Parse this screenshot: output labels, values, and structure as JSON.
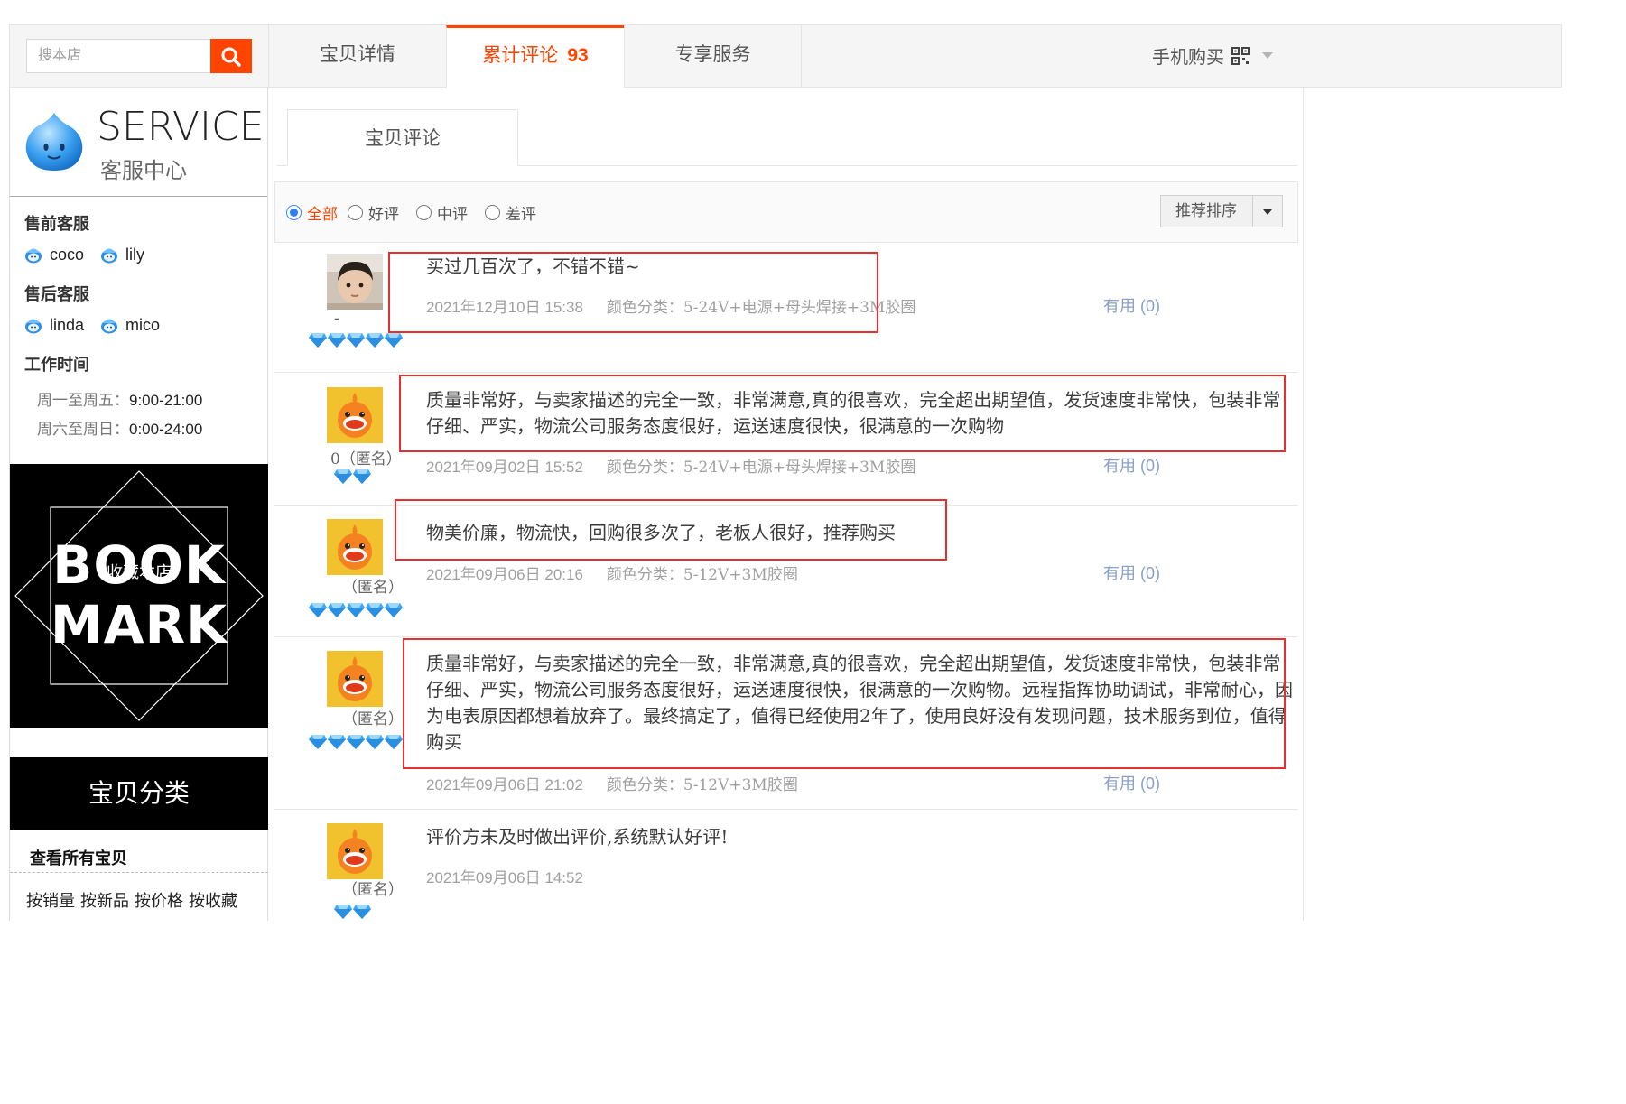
{
  "search": {
    "placeholder": "搜本店"
  },
  "tabs": [
    {
      "label": "宝贝详情"
    },
    {
      "label": "累计评论",
      "count": "93"
    },
    {
      "label": "专享服务"
    }
  ],
  "mobile_buy": "手机购买",
  "service": {
    "brand": "SERVICE",
    "subtitle": "客服中心",
    "presale_title": "售前客服",
    "presale": [
      "coco",
      "lily"
    ],
    "aftersale_title": "售后客服",
    "aftersale": [
      "linda",
      "mico"
    ],
    "hours_title": "工作时间",
    "hours": [
      {
        "days": "周一至周五：",
        "time": "9:00-21:00"
      },
      {
        "days": "周六至周日：",
        "time": "0:00-24:00"
      }
    ]
  },
  "bookmark": {
    "line1": "BOOK",
    "line2": "MARK",
    "overlay": "收藏本店"
  },
  "category": {
    "title": "宝贝分类",
    "all": "查看所有宝贝",
    "links": [
      "按销量",
      "按新品",
      "按价格",
      "按收藏"
    ]
  },
  "reviews_tab": "宝贝评论",
  "filters": [
    "全部",
    "好评",
    "中评",
    "差评"
  ],
  "sort_label": "推荐排序",
  "reviews": [
    {
      "user": "-",
      "anonymous": false,
      "gems": 5,
      "text": "买过几百次了，不错不错~",
      "date": "2021年12月10日 15:38",
      "sku": "颜色分类：5-24V+电源+母头焊接+3M胶圈",
      "useful": "有用 (0)",
      "avatar": "photo"
    },
    {
      "user": "0（匿名）",
      "anonymous": true,
      "gems": 2,
      "text": "质量非常好，与卖家描述的完全一致，非常满意,真的很喜欢，完全超出期望值，发货速度非常快，包装非常仔细、严实，物流公司服务态度很好，运送速度很快，很满意的一次购物",
      "date": "2021年09月02日 15:52",
      "sku": "颜色分类：5-24V+电源+母头焊接+3M胶圈",
      "useful": "有用 (0)",
      "avatar": "mascot"
    },
    {
      "user": "（匿名）",
      "anonymous": true,
      "gems": 5,
      "text": "物美价廉，物流快，回购很多次了，老板人很好，推荐购买",
      "date": "2021年09月06日 20:16",
      "sku": "颜色分类：5-12V+3M胶圈",
      "useful": "有用 (0)",
      "avatar": "mascot"
    },
    {
      "user": "（匿名）",
      "anonymous": true,
      "gems": 5,
      "text": "质量非常好，与卖家描述的完全一致，非常满意,真的很喜欢，完全超出期望值，发货速度非常快，包装非常仔细、严实，物流公司服务态度很好，运送速度很快，很满意的一次购物。远程指挥协助调试，非常耐心，因为电表原因都想着放弃了。最终搞定了，值得已经使用2年了，使用良好没有发现问题，技术服务到位，值得购买",
      "date": "2021年09月06日 21:02",
      "sku": "颜色分类：5-12V+3M胶圈",
      "useful": "有用 (0)",
      "avatar": "mascot"
    },
    {
      "user": "（匿名）",
      "anonymous": true,
      "gems": 2,
      "text": "评价方未及时做出评价,系统默认好评!",
      "date": "2021年09月06日 14:52",
      "sku": "",
      "useful": "",
      "avatar": "mascot"
    }
  ],
  "colors": {
    "accent": "#ff4400",
    "highlight": "#e53030",
    "gem": "#3fa9f5"
  }
}
